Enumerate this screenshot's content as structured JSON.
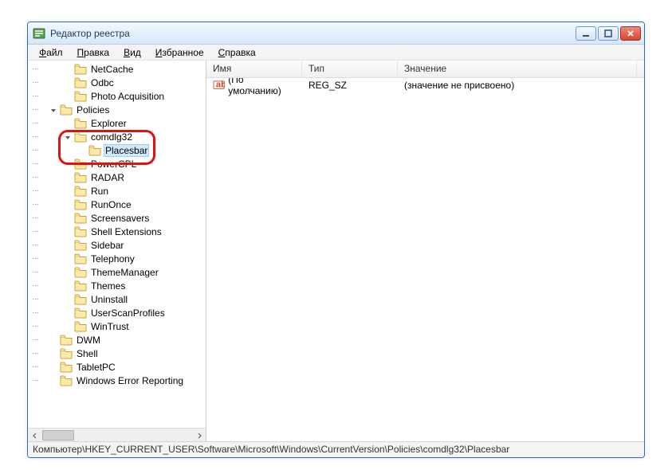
{
  "window": {
    "title": "Редактор реестра"
  },
  "menu": [
    "Файл",
    "Правка",
    "Вид",
    "Избранное",
    "Справка"
  ],
  "tree": [
    {
      "indent": 2,
      "label": "NetCache"
    },
    {
      "indent": 2,
      "label": "Odbc"
    },
    {
      "indent": 2,
      "label": "Photo Acquisition"
    },
    {
      "indent": 1,
      "label": "Policies",
      "expanded": true
    },
    {
      "indent": 2,
      "label": "Explorer",
      "vbar": true
    },
    {
      "indent": 2,
      "label": "comdlg32",
      "expanded": true,
      "anno": true
    },
    {
      "indent": 3,
      "label": "Placesbar",
      "selected": true,
      "anno": true
    },
    {
      "indent": 2,
      "label": "PowerCPL"
    },
    {
      "indent": 2,
      "label": "RADAR"
    },
    {
      "indent": 2,
      "label": "Run"
    },
    {
      "indent": 2,
      "label": "RunOnce"
    },
    {
      "indent": 2,
      "label": "Screensavers"
    },
    {
      "indent": 2,
      "label": "Shell Extensions"
    },
    {
      "indent": 2,
      "label": "Sidebar"
    },
    {
      "indent": 2,
      "label": "Telephony"
    },
    {
      "indent": 2,
      "label": "ThemeManager"
    },
    {
      "indent": 2,
      "label": "Themes"
    },
    {
      "indent": 2,
      "label": "Uninstall"
    },
    {
      "indent": 2,
      "label": "UserScanProfiles"
    },
    {
      "indent": 2,
      "label": "WinTrust"
    },
    {
      "indent": 1,
      "label": "DWM"
    },
    {
      "indent": 1,
      "label": "Shell"
    },
    {
      "indent": 1,
      "label": "TabletPC"
    },
    {
      "indent": 1,
      "label": "Windows Error Reporting",
      "truncated": true
    }
  ],
  "list": {
    "columns": {
      "name": "Имя",
      "type": "Тип",
      "value": "Значение"
    },
    "widths": {
      "name": 120,
      "type": 120,
      "value": 300
    },
    "rows": [
      {
        "name": "(По умолчанию)",
        "type": "REG_SZ",
        "value": "(значение не присвоено)"
      }
    ]
  },
  "status": "Компьютер\\HKEY_CURRENT_USER\\Software\\Microsoft\\Windows\\CurrentVersion\\Policies\\comdlg32\\Placesbar"
}
